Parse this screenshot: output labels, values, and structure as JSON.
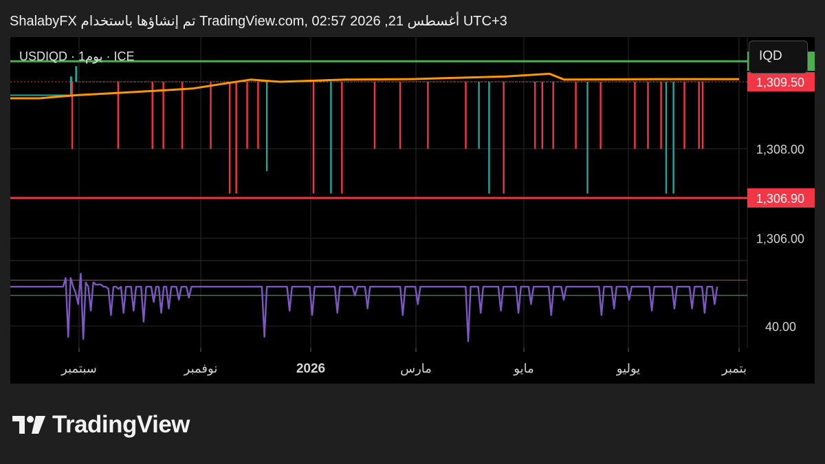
{
  "header": {
    "text": "ShalabyFX تم إنشاؤها باستخدام TradingView.com, 02:57 2026 ,21 أغسطس UTC+3"
  },
  "chart": {
    "symbol_label": "USDIQD · 1يوم · ICE",
    "currency_button": "IQD"
  },
  "footer": {
    "brand": "TradingView"
  },
  "colors": {
    "background": "#000000",
    "upper_level": "#4caf50",
    "lower_level": "#f23645",
    "price_tag": "#f23645",
    "moving_average": "#ff9800",
    "candle_down": "#f23645",
    "candle_up": "#26a69a",
    "oscillator": "#7e57c2"
  },
  "chart_data": [
    {
      "type": "candlestick",
      "x_tick_labels": [
        "سبتمبر",
        "نوفمبر",
        "2026",
        "مارس",
        "مايو",
        "يوليو",
        "بتمبر"
      ],
      "y_tick_labels": [
        "1,308.00",
        "1,306.00"
      ],
      "ylim": [
        1305.5,
        1310.5
      ],
      "price_tags": [
        {
          "label": "1,309.96",
          "value": 1309.96,
          "color": "#4caf50"
        },
        {
          "label": "1,309.50",
          "value": 1309.5,
          "color": "#f23645"
        },
        {
          "label": "1,306.90",
          "value": 1306.9,
          "color": "#f23645"
        }
      ],
      "horizontal_lines": [
        {
          "value": 1309.96,
          "color": "#4caf50"
        },
        {
          "value": 1306.9,
          "color": "#f23645"
        }
      ],
      "current_price": 1309.5,
      "moving_average": {
        "color": "#ff9800",
        "points": [
          [
            0.0,
            1309.13
          ],
          [
            0.04,
            1309.13
          ],
          [
            0.09,
            1309.2
          ],
          [
            0.18,
            1309.28
          ],
          [
            0.25,
            1309.35
          ],
          [
            0.29,
            1309.45
          ],
          [
            0.33,
            1309.55
          ],
          [
            0.37,
            1309.5
          ],
          [
            0.46,
            1309.55
          ],
          [
            0.55,
            1309.56
          ],
          [
            0.68,
            1309.62
          ],
          [
            0.74,
            1309.68
          ],
          [
            0.76,
            1309.55
          ],
          [
            0.89,
            1309.56
          ],
          [
            1.0,
            1309.56
          ]
        ]
      },
      "wicks": [
        {
          "x": 0.085,
          "low": 1308.0,
          "dir": "down"
        },
        {
          "x": 0.148,
          "low": 1308.0,
          "dir": "down"
        },
        {
          "x": 0.195,
          "low": 1308.0,
          "dir": "down"
        },
        {
          "x": 0.21,
          "low": 1308.0,
          "dir": "down"
        },
        {
          "x": 0.236,
          "low": 1308.0,
          "dir": "down"
        },
        {
          "x": 0.275,
          "low": 1308.0,
          "dir": "down"
        },
        {
          "x": 0.301,
          "low": 1307.0,
          "dir": "down"
        },
        {
          "x": 0.31,
          "low": 1307.0,
          "dir": "down"
        },
        {
          "x": 0.325,
          "low": 1308.0,
          "dir": "down"
        },
        {
          "x": 0.34,
          "low": 1308.0,
          "dir": "down"
        },
        {
          "x": 0.352,
          "low": 1307.5,
          "dir": "up"
        },
        {
          "x": 0.416,
          "low": 1307.0,
          "dir": "down"
        },
        {
          "x": 0.44,
          "low": 1307.0,
          "dir": "up"
        },
        {
          "x": 0.455,
          "low": 1307.0,
          "dir": "down"
        },
        {
          "x": 0.5,
          "low": 1308.0,
          "dir": "down"
        },
        {
          "x": 0.535,
          "low": 1308.0,
          "dir": "down"
        },
        {
          "x": 0.573,
          "low": 1308.0,
          "dir": "down"
        },
        {
          "x": 0.625,
          "low": 1308.0,
          "dir": "down"
        },
        {
          "x": 0.643,
          "low": 1308.0,
          "dir": "up"
        },
        {
          "x": 0.657,
          "low": 1307.0,
          "dir": "up"
        },
        {
          "x": 0.677,
          "low": 1307.0,
          "dir": "down"
        },
        {
          "x": 0.72,
          "low": 1308.0,
          "dir": "down"
        },
        {
          "x": 0.73,
          "low": 1308.0,
          "dir": "down"
        },
        {
          "x": 0.745,
          "low": 1308.0,
          "dir": "down"
        },
        {
          "x": 0.776,
          "low": 1308.0,
          "dir": "down"
        },
        {
          "x": 0.792,
          "low": 1307.0,
          "dir": "up"
        },
        {
          "x": 0.81,
          "low": 1308.0,
          "dir": "down"
        },
        {
          "x": 0.857,
          "low": 1308.0,
          "dir": "down"
        },
        {
          "x": 0.875,
          "low": 1308.0,
          "dir": "down"
        },
        {
          "x": 0.893,
          "low": 1308.0,
          "dir": "down"
        },
        {
          "x": 0.9,
          "low": 1307.0,
          "dir": "up"
        },
        {
          "x": 0.91,
          "low": 1307.0,
          "dir": "up"
        },
        {
          "x": 0.925,
          "low": 1308.0,
          "dir": "down"
        },
        {
          "x": 0.945,
          "low": 1308.0,
          "dir": "down"
        },
        {
          "x": 0.95,
          "low": 1308.0,
          "dir": "down"
        }
      ]
    },
    {
      "type": "line",
      "name": "oscillator",
      "y_tick_labels": [
        "40.00"
      ],
      "ylim": [
        30,
        70
      ],
      "upper_band": 61,
      "lower_band": 54,
      "color": "#7e57c2",
      "values": [
        58,
        58,
        58,
        58,
        58,
        58,
        58,
        58,
        58,
        58,
        58,
        58,
        58,
        58,
        58,
        58,
        58,
        58,
        58,
        58,
        58,
        58,
        62,
        35,
        62,
        58,
        55,
        50,
        64,
        34,
        60,
        58,
        47,
        60,
        59,
        59,
        59,
        58,
        58,
        57,
        45,
        58,
        58,
        57,
        58,
        46,
        58,
        58,
        58,
        47,
        58,
        58,
        58,
        42,
        58,
        58,
        58,
        51,
        58,
        58,
        46,
        58,
        58,
        48,
        58,
        58,
        58,
        52,
        58,
        58,
        58,
        53,
        58,
        58,
        58,
        58,
        58,
        58,
        58,
        58,
        58,
        58,
        58,
        58,
        58,
        58,
        58,
        58,
        58,
        58,
        58,
        58,
        58,
        58,
        58,
        58,
        58,
        58,
        58,
        58,
        58,
        35,
        58,
        58,
        58,
        58,
        58,
        58,
        58,
        58,
        58,
        47,
        58,
        58,
        58,
        58,
        58,
        58,
        58,
        58,
        45,
        58,
        58,
        58,
        58,
        58,
        58,
        58,
        58,
        58,
        46,
        58,
        58,
        58,
        58,
        58,
        58,
        54,
        58,
        58,
        58,
        58,
        48,
        58,
        58,
        58,
        58,
        58,
        58,
        58,
        58,
        58,
        58,
        58,
        58,
        58,
        45,
        58,
        58,
        58,
        58,
        58,
        50,
        58,
        58,
        58,
        58,
        58,
        58,
        58,
        58,
        58,
        58,
        58,
        58,
        58,
        58,
        58,
        58,
        58,
        58,
        58,
        33,
        58,
        58,
        58,
        58,
        46,
        58,
        58,
        58,
        58,
        58,
        58,
        58,
        47,
        58,
        58,
        58,
        58,
        58,
        58,
        46,
        58,
        58,
        58,
        58,
        50,
        58,
        58,
        58,
        58,
        58,
        58,
        58,
        45,
        58,
        58,
        58,
        58,
        52,
        58,
        58,
        58,
        58,
        58,
        58,
        58,
        58,
        58,
        58,
        58,
        58,
        58,
        58,
        45,
        58,
        58,
        58,
        58,
        48,
        58,
        58,
        58,
        58,
        58,
        52,
        58,
        58,
        58,
        58,
        58,
        58,
        58,
        58,
        47,
        58,
        58,
        58,
        58,
        58,
        58,
        58,
        58,
        48,
        58,
        58,
        58,
        58,
        58,
        58,
        48,
        58,
        58,
        58,
        58,
        46,
        58,
        58,
        58,
        50,
        58
      ]
    }
  ]
}
